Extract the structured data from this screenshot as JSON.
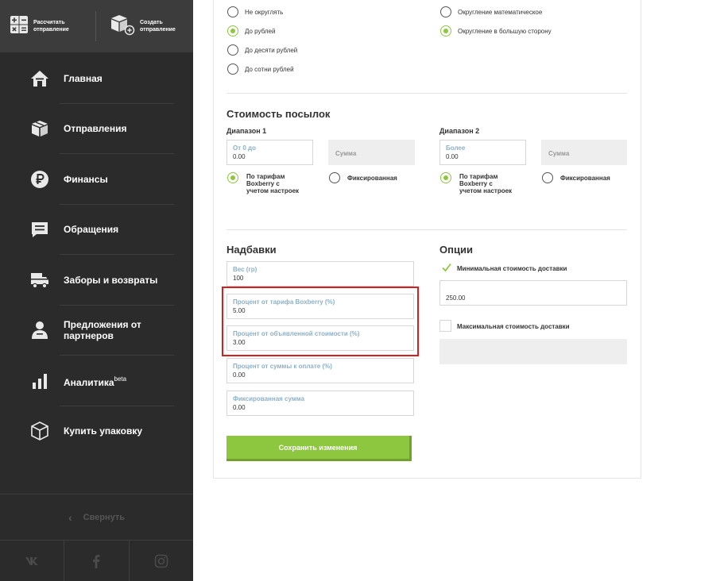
{
  "sidebar": {
    "top_buttons": [
      {
        "label_line1": "Рассчитать",
        "label_line2": "отправление",
        "icon": "calculator-icon"
      },
      {
        "label_line1": "Создать",
        "label_line2": "отправление",
        "icon": "create-parcel-icon"
      }
    ],
    "items": [
      {
        "label": "Главная",
        "icon": "home-icon"
      },
      {
        "label": "Отправления",
        "icon": "parcels-icon"
      },
      {
        "label": "Финансы",
        "icon": "ruble-icon"
      },
      {
        "label": "Обращения",
        "icon": "chat-icon"
      },
      {
        "label": "Заборы и возвраты",
        "icon": "truck-icon"
      },
      {
        "label_line1": "Предложения от",
        "label_line2": "партнеров",
        "icon": "partners-icon"
      },
      {
        "label": "Аналитика",
        "sup": "beta",
        "icon": "analytics-icon"
      },
      {
        "label": "Купить упаковку",
        "icon": "box-icon"
      }
    ],
    "collapse_label": "Свернуть",
    "social": [
      "vk-icon",
      "facebook-icon",
      "instagram-icon"
    ]
  },
  "rounding": {
    "left": [
      {
        "label": "Не округлять",
        "selected": false
      },
      {
        "label": "До рублей",
        "selected": true
      },
      {
        "label": "До десяти рублей",
        "selected": false
      },
      {
        "label": "До сотни рублей",
        "selected": false
      }
    ],
    "right": [
      {
        "label": "Округление математическое",
        "selected": false
      },
      {
        "label": "Округление в большую сторону",
        "selected": true
      }
    ]
  },
  "parcel_cost": {
    "title": "Стоимость посылок",
    "range1": {
      "title": "Диапазон 1",
      "field_label": "От 0 до",
      "field_value": "0.00",
      "sum_placeholder": "Сумма",
      "option_tariff": [
        "По тарифам",
        "Boxberry с",
        "учетом настроек"
      ],
      "option_fixed": "Фиксированная"
    },
    "range2": {
      "title": "Диапазон 2",
      "field_label": "Более",
      "field_value": "0.00",
      "sum_placeholder": "Сумма",
      "option_tariff": [
        "По тарифам",
        "Boxberry с",
        "учетом настроек"
      ],
      "option_fixed": "Фиксированная"
    }
  },
  "surcharges": {
    "title": "Надбавки",
    "fields": [
      {
        "label": "Вес (гр)",
        "value": "100"
      },
      {
        "label": "Процент от тарифа Boxberry (%)",
        "value": "5.00"
      },
      {
        "label": "Процент от объявленной стоимости (%)",
        "value": "3.00"
      },
      {
        "label": "Процент от суммы к оплате (%)",
        "value": "0.00"
      },
      {
        "label": "Фиксированная сумма",
        "value": "0.00"
      }
    ]
  },
  "options": {
    "title": "Опции",
    "min_delivery": {
      "label": "Минимальная стоимость доставки",
      "checked": true,
      "value": "250.00"
    },
    "max_delivery": {
      "label": "Максимальная стоимость доставки",
      "checked": false,
      "value": ""
    }
  },
  "save_button": "Сохранить изменения",
  "colors": {
    "accent": "#8dc63f",
    "sidebar": "#2b2b2b",
    "highlight": "#d62020",
    "field_label": "#8cb0c8"
  }
}
